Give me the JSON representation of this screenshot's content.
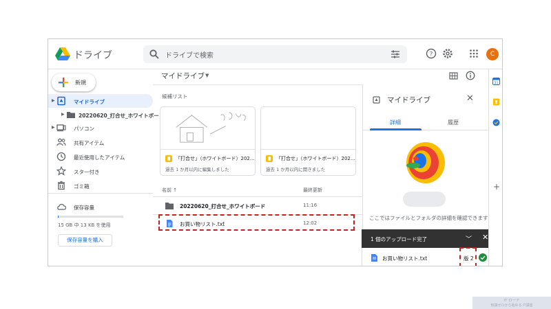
{
  "header": {
    "app_name": "ドライブ",
    "search_placeholder": "ドライブで検索",
    "avatar_letter": "C"
  },
  "sidebar": {
    "new_label": "新規",
    "items": [
      {
        "label": "マイドライブ",
        "icon": "my-drive-icon",
        "active": true
      },
      {
        "label": "20220620_打合せ_ホワイトボード",
        "icon": "folder-icon",
        "sub": true
      },
      {
        "label": "パソコン",
        "icon": "computer-icon"
      },
      {
        "label": "共有アイテム",
        "icon": "shared-icon"
      },
      {
        "label": "最近使用したアイテム",
        "icon": "clock-icon"
      },
      {
        "label": "スター付き",
        "icon": "star-icon"
      },
      {
        "label": "ゴミ箱",
        "icon": "trash-icon"
      }
    ],
    "storage_label": "保存容量",
    "storage_usage": "15 GB 中 13 KB を使用",
    "storage_fraction": 0.001,
    "buy_storage": "保存容量を購入"
  },
  "main": {
    "breadcrumb": "マイドライブ",
    "suggested_label": "候補リスト",
    "suggested": [
      {
        "title": "「打合せ」（ホワイトボード）202...",
        "subtitle": "過去 1 か月以内に編集しました"
      },
      {
        "title": "「打合せ」（ホワイトボード）202...",
        "subtitle": "過去 1 か月以内に開きました"
      }
    ],
    "col_name": "名前 ↑",
    "col_modified": "最終更新",
    "files": [
      {
        "name": "20220620_打合せ_ホワイトボード",
        "modified": "11:16",
        "type": "folder"
      },
      {
        "name": "お買い物リスト.txt",
        "modified": "12:02",
        "type": "doc"
      }
    ]
  },
  "details": {
    "title": "マイドライブ",
    "tab_details": "詳細",
    "tab_activity": "履歴",
    "info_text": "ここではファイルとフォルダの詳細を確認できます"
  },
  "upload": {
    "title": "1 個のアップロード完了",
    "file_name": "お買い物リスト.txt",
    "version": "版 2"
  },
  "watermark": {
    "line1": "IT ロード",
    "line2": "知識ゼロから始める IT講座"
  },
  "colors": {
    "accent": "#1a73e8",
    "active_bg": "#e8f0fe",
    "highlight": "#c5221f",
    "toast": "#323232",
    "success": "#1e8e3e"
  }
}
